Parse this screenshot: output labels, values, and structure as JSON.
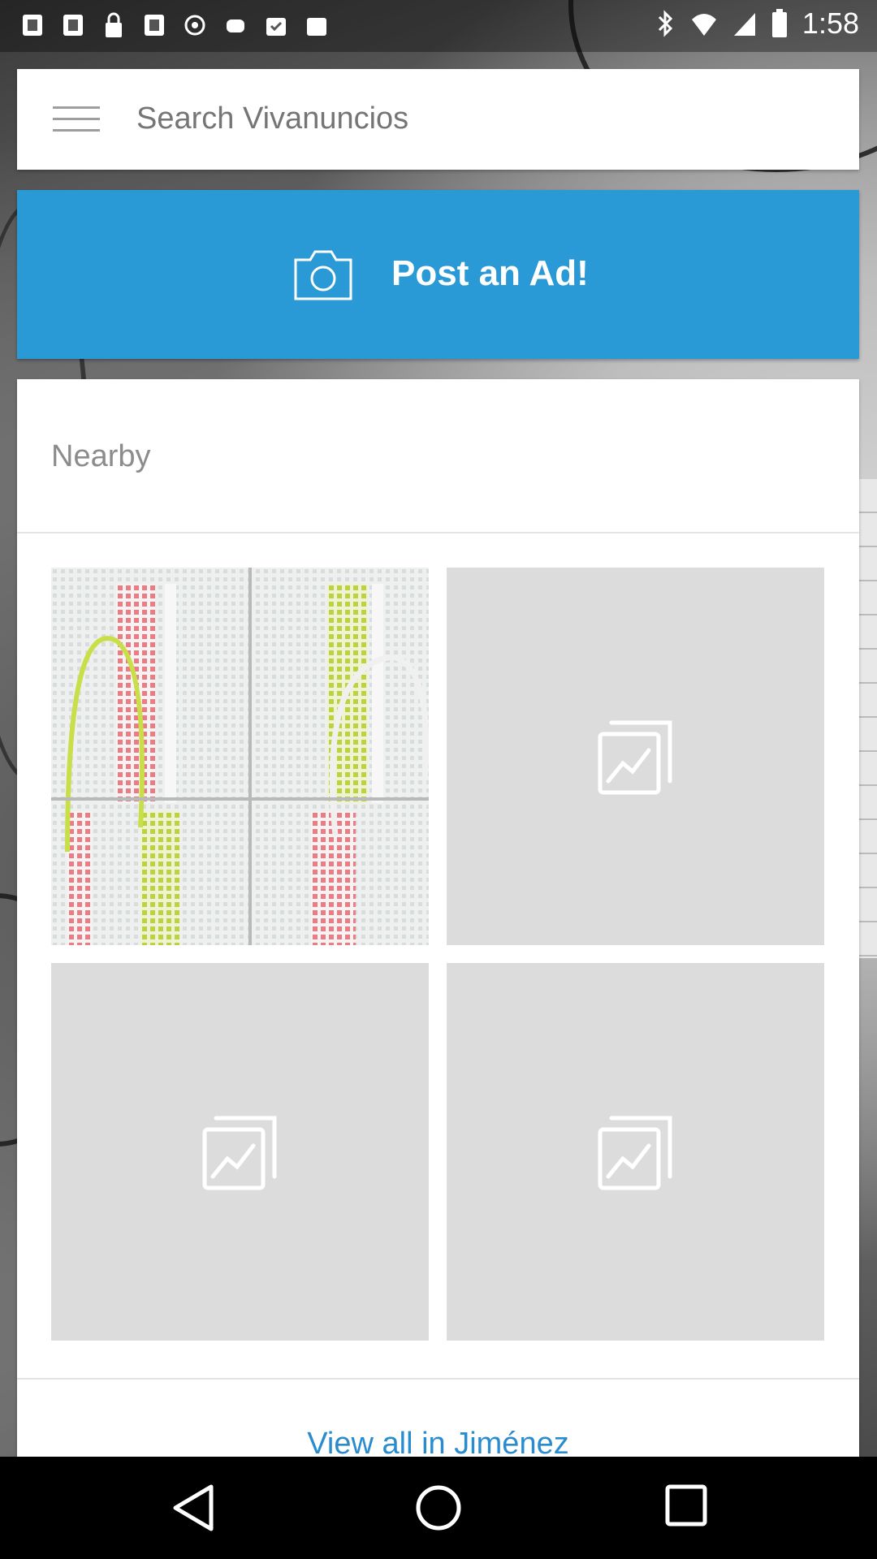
{
  "status_bar": {
    "time": "1:58"
  },
  "search": {
    "placeholder": "Search Vivanuncios"
  },
  "post_ad": {
    "label": "Post an Ad!"
  },
  "nearby": {
    "title": "Nearby",
    "view_all": "View all in Jiménez"
  },
  "colors": {
    "accent": "#2a9ad6",
    "link": "#2a8ccd"
  },
  "icons": [
    "menu-icon",
    "camera-icon",
    "image-placeholder-icon",
    "back-icon",
    "home-icon",
    "recents-icon"
  ]
}
